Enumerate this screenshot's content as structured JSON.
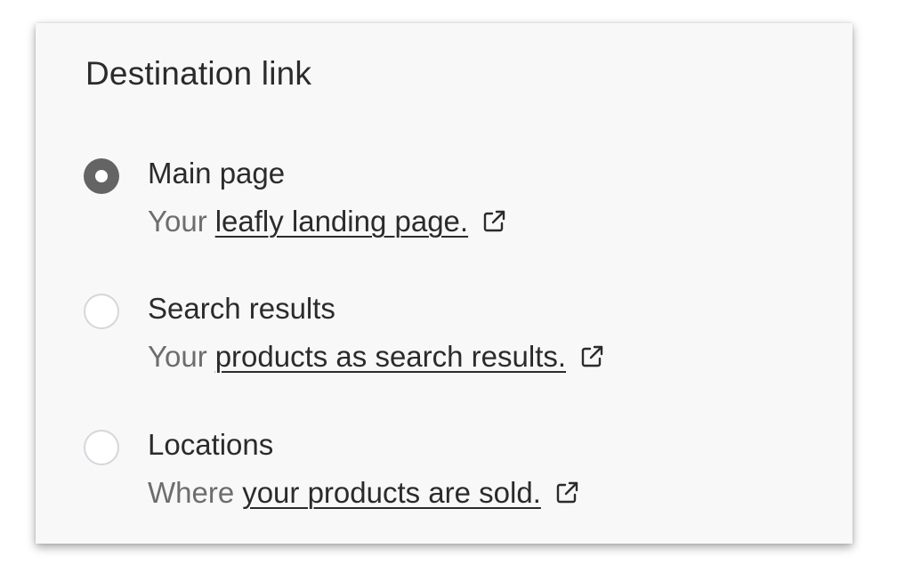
{
  "panel": {
    "title": "Destination link"
  },
  "options": [
    {
      "label": "Main page",
      "prefix": "Your",
      "link_text": "leafly landing page.",
      "selected": true,
      "icon": "external-link-icon"
    },
    {
      "label": "Search results",
      "prefix": "Your",
      "link_text": "products as search results.",
      "selected": false,
      "icon": "external-link-icon"
    },
    {
      "label": "Locations",
      "prefix": "Where",
      "link_text": "your products are sold.",
      "selected": false,
      "icon": "external-link-icon"
    }
  ],
  "colors": {
    "radio_selected": "#646464",
    "radio_border": "#d6d6dc",
    "text_primary": "#2b2b2b",
    "text_secondary": "#6d6d6d",
    "card_bg": "#f8f8f8"
  }
}
